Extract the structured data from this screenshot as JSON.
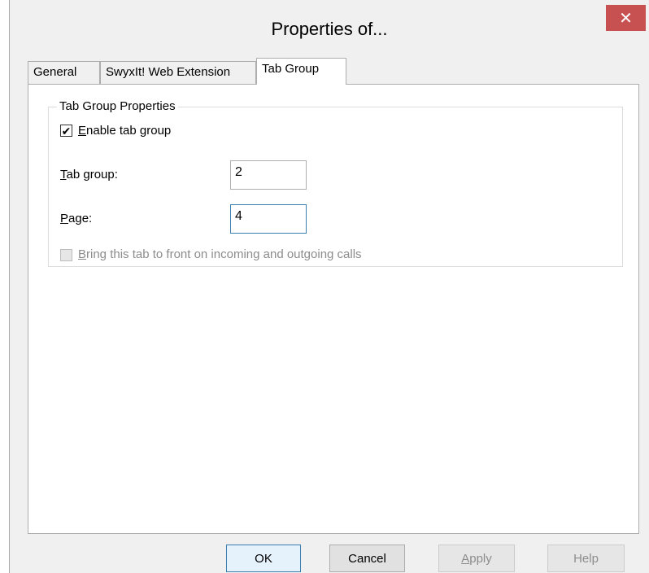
{
  "window": {
    "title": "Properties of...",
    "close_glyph": "✕"
  },
  "tabs": [
    {
      "label": "General",
      "active": false
    },
    {
      "label": "SwyxIt! Web Extension",
      "active": false
    },
    {
      "label": "Tab Group",
      "active": true
    }
  ],
  "tab_group": {
    "legend": "Tab Group Properties",
    "enable": {
      "mnemonic": "E",
      "rest": "nable tab group",
      "checked": true,
      "glyph": "✔"
    },
    "tab_group_field": {
      "mnemonic": "T",
      "rest": "ab group:",
      "value": "2"
    },
    "page_field": {
      "mnemonic": "P",
      "rest": "age:",
      "value": "4"
    },
    "bring_to_front": {
      "mnemonic": "B",
      "rest": "ring this tab to front on incoming and outgoing calls",
      "checked": false,
      "enabled": false
    }
  },
  "buttons": {
    "ok": "OK",
    "cancel": "Cancel",
    "apply_mnemonic": "A",
    "apply_rest": "pply",
    "help": "Help"
  },
  "colors": {
    "close_button": "#c75050",
    "focus_border": "#3c7fb1"
  }
}
